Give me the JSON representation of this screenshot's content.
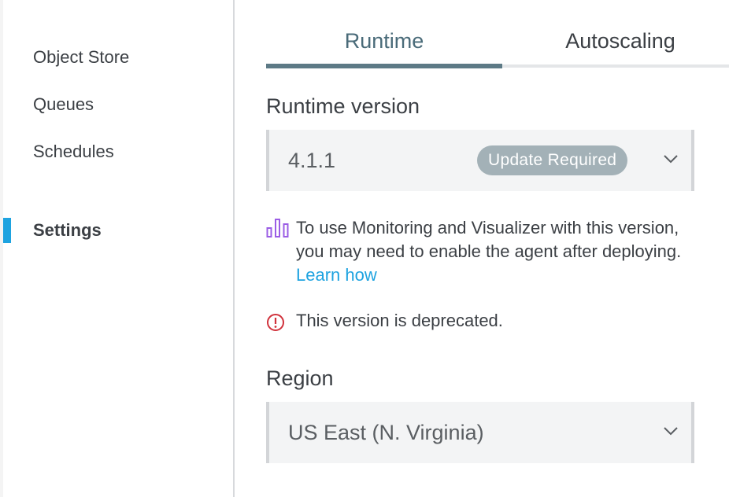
{
  "sidebar": {
    "items": [
      {
        "label": "Object Store",
        "active": false
      },
      {
        "label": "Queues",
        "active": false
      },
      {
        "label": "Schedules",
        "active": false
      },
      {
        "label": "Settings",
        "active": true
      }
    ]
  },
  "tabs": [
    {
      "label": "Runtime",
      "active": true
    },
    {
      "label": "Autoscaling",
      "active": false
    }
  ],
  "runtime": {
    "label": "Runtime version",
    "value": "4.1.1",
    "badge": "Update Required",
    "monitoring_notice_text": "To use Monitoring and Visualizer with this version, you may need to enable the agent after deploying.",
    "monitoring_notice_link": "Learn how",
    "deprecated_notice": "This version is deprecated."
  },
  "region": {
    "label": "Region",
    "value": "US East (N. Virginia)"
  },
  "colors": {
    "accent": "#1ea3e0",
    "tab_active": "#5d7a86",
    "badge_bg": "#a3b1b7",
    "error": "#d0313b",
    "monitor_icon": "#9b5de5"
  }
}
